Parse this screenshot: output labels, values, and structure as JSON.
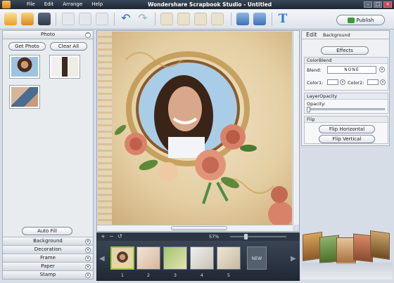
{
  "window": {
    "title": "Wondershare Scrapbook Studio - Untitled",
    "menu": [
      "File",
      "Edit",
      "Arrange",
      "Help"
    ]
  },
  "toolbar": {
    "publish_label": "Publish",
    "icons": [
      "new-icon",
      "open-icon",
      "save-icon",
      "cut-icon",
      "copy-icon",
      "paste-icon",
      "undo-icon",
      "redo-icon",
      "bring-front-icon",
      "send-back-icon",
      "bring-forward-icon",
      "send-backward-icon",
      "flip-horizontal-icon",
      "flip-vertical-icon",
      "text-icon"
    ]
  },
  "left_panel": {
    "header": "Photo",
    "get_photo_label": "Get Photo",
    "clear_all_label": "Clear All",
    "auto_fill_label": "Auto Fill",
    "sections": [
      "Background",
      "Decoration",
      "Frame",
      "Paper",
      "Stamp"
    ]
  },
  "zoom": {
    "value": "57%"
  },
  "filmstrip": {
    "pages": [
      "1",
      "2",
      "3",
      "4",
      "5"
    ],
    "new_label": "NEW"
  },
  "right_panel": {
    "tab_edit": "Edit",
    "tab_background": "Background",
    "effects_label": "Effects",
    "colorblend_header": "ColorBlend",
    "blend_label": "Blend:",
    "blend_value": "NONE",
    "color1_label": "Color1:",
    "color2_label": "Color2:",
    "layeropacity_header": "LayerOpacity",
    "opacity_label": "Opacity:",
    "flip_header": "Flip",
    "flip_horizontal_label": "Flip Horizontal",
    "flip_vertical_label": "Flip Vertical"
  },
  "colors": {
    "titlebar": "#2a3444",
    "accent": "#9acd32",
    "page_paper": "#e4cfa3"
  }
}
